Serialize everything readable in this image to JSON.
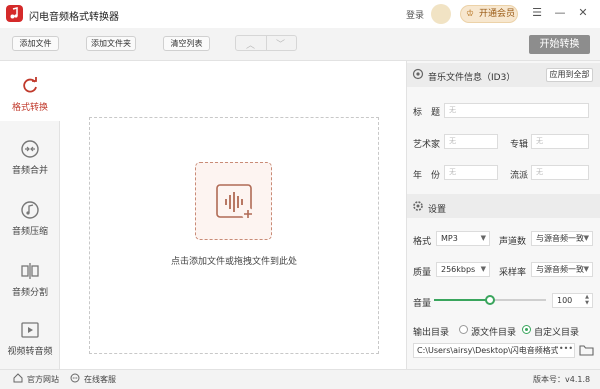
{
  "app": {
    "title": "闪电音频格式转换器",
    "login": "登录",
    "vip": "开通会员"
  },
  "toolbar": {
    "add_file": "添加文件",
    "add_folder": "添加文件夹",
    "clear_list": "清空列表",
    "start": "开始转换"
  },
  "sidebar": {
    "items": [
      {
        "label": "格式转换",
        "icon": "refresh-icon",
        "active": true
      },
      {
        "label": "音频合并",
        "icon": "merge-icon"
      },
      {
        "label": "音频压缩",
        "icon": "music-note-icon"
      },
      {
        "label": "音频分割",
        "icon": "split-icon"
      },
      {
        "label": "视频转音频",
        "icon": "video-play-icon"
      }
    ]
  },
  "main": {
    "drop_text": "点击添加文件或拖拽文件到此处"
  },
  "id3": {
    "title": "音乐文件信息（ID3）",
    "apply_all": "应用到全部",
    "fields": {
      "title": {
        "label": "标　题",
        "placeholder": "无"
      },
      "artist": {
        "label": "艺术家",
        "placeholder": "无"
      },
      "album": {
        "label": "专辑",
        "placeholder": "无"
      },
      "year": {
        "label": "年　份",
        "placeholder": "无"
      },
      "genre": {
        "label": "流派",
        "placeholder": "无"
      }
    }
  },
  "settings": {
    "title": "设置",
    "format_label": "格式",
    "format_value": "MP3",
    "channels_label": "声道数",
    "channels_value": "与源音频一致",
    "quality_label": "质量",
    "quality_value": "256kbps",
    "samplerate_label": "采样率",
    "samplerate_value": "与源音频一致",
    "volume_label": "音量",
    "volume_value": "100",
    "volume_fraction": 0.5,
    "output_label": "输出目录",
    "source_dir_option": "源文件目录",
    "custom_dir_option": "自定义目录",
    "selected_output": "custom",
    "output_path": "C:\\Users\\airsy\\Desktop\\闪电音频格式转换"
  },
  "footer": {
    "website": "官方网站",
    "support": "在线客服",
    "version": "版本号：v4.1.8"
  },
  "colors": {
    "accent": "#c0392b",
    "green": "#3aa55d",
    "start_button": "#8d8d8d"
  }
}
